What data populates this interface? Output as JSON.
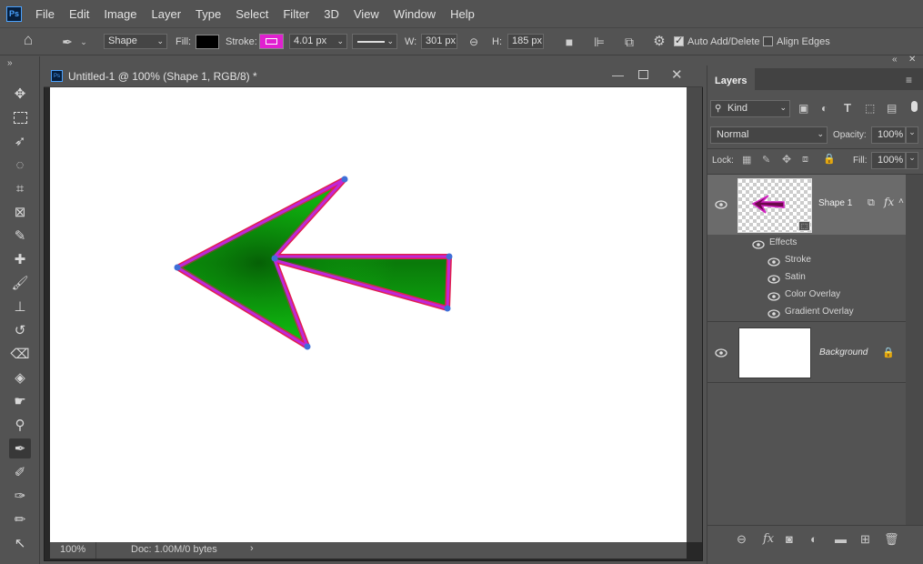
{
  "app": {
    "logo": "Ps"
  },
  "menu": [
    "File",
    "Edit",
    "Image",
    "Layer",
    "Type",
    "Select",
    "Filter",
    "3D",
    "View",
    "Window",
    "Help"
  ],
  "options": {
    "mode": "Shape",
    "fill_label": "Fill:",
    "stroke_label": "Stroke:",
    "stroke_width": "4.01 px",
    "w_label": "W:",
    "w_value": "301 px",
    "h_label": "H:",
    "h_value": "185 px",
    "auto_add_delete": "Auto Add/Delete",
    "align_edges": "Align Edges",
    "fill_color": "#000000",
    "stroke_color": "#e020d0"
  },
  "document": {
    "title": "Untitled-1 @ 100% (Shape 1, RGB/8) *",
    "zoom": "100%",
    "doc_info": "Doc: 1.00M/0 bytes"
  },
  "layers_panel": {
    "title": "Layers",
    "filter": "Kind",
    "blend_mode": "Normal",
    "opacity_label": "Opacity:",
    "opacity": "100%",
    "lock_label": "Lock:",
    "fill_label": "Fill:",
    "fill": "100%",
    "layers": [
      {
        "name": "Shape 1",
        "effects_label": "Effects",
        "effects": [
          "Stroke",
          "Satin",
          "Color Overlay",
          "Gradient Overlay"
        ]
      },
      {
        "name": "Background"
      }
    ]
  },
  "colors": {
    "arrow_fill": "#0bb00b",
    "arrow_stroke_outer": "#e0204e",
    "arrow_stroke_inner": "#c026d8",
    "anchor": "#3f6fd8"
  }
}
